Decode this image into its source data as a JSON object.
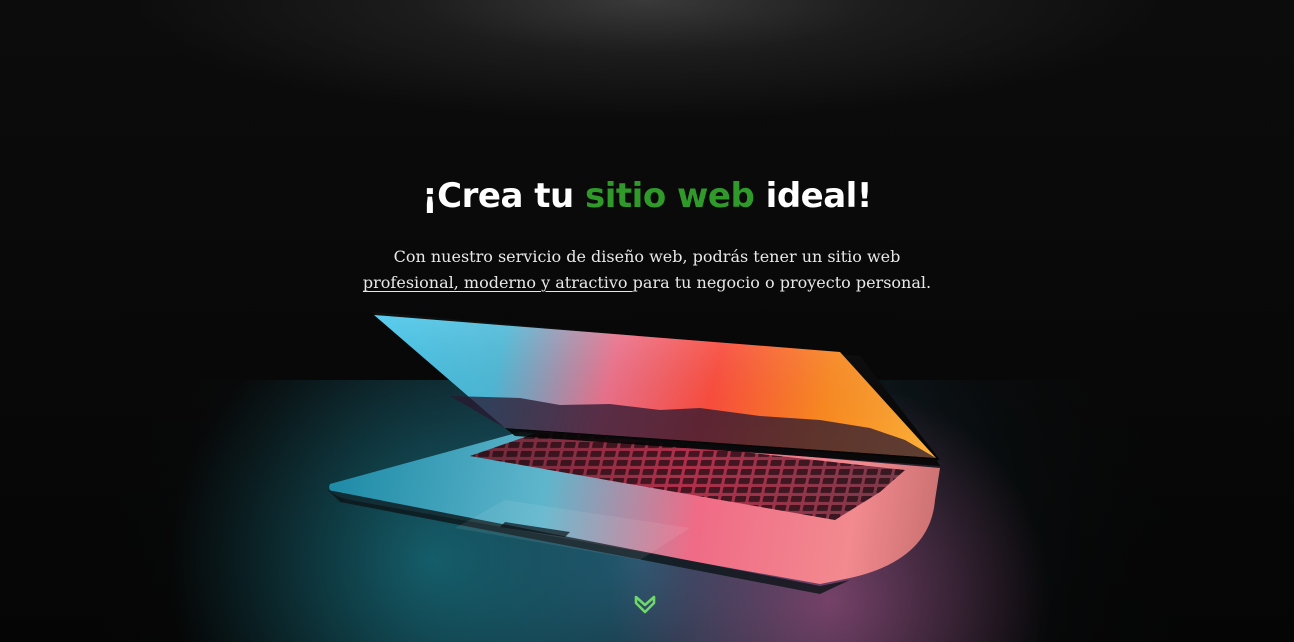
{
  "hero": {
    "title_part1": "¡Crea tu ",
    "title_accent": "sitio web",
    "title_part2": " ideal!",
    "text_line1": "Con nuestro servicio de diseño web, podrás tener un sitio web",
    "text_highlight": "profesional, moderno y atractivo ",
    "text_line2_rest": "para tu negocio o proyecto personal."
  },
  "colors": {
    "accent": "#2f9a2a",
    "icon": "#6fd86a",
    "background": "#070707",
    "text": "#e8e8e8"
  },
  "icons": {
    "scroll": "chevron-down-icon"
  }
}
